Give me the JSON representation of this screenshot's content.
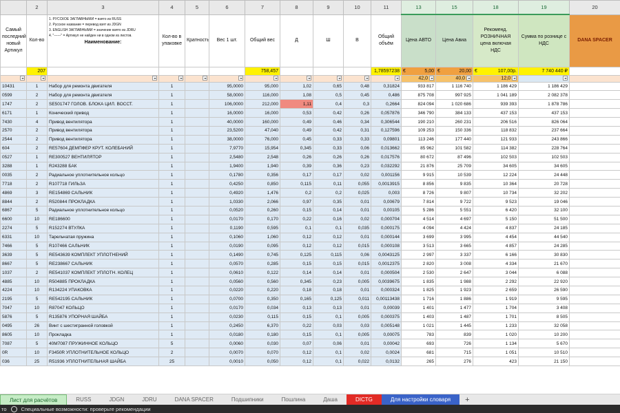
{
  "columns": [
    "",
    "2",
    "3",
    "4",
    "5",
    "6",
    "7",
    "8",
    "9",
    "10",
    "11",
    "13",
    "15",
    "18",
    "19",
    "20"
  ],
  "header": {
    "c1": "Самый последний новый Артикул",
    "c2": "Кол-во",
    "c3": [
      "1. РУССКОЕ ЗАГЛАВНЫМИ = взято из RUSS",
      "2. Русское название = перевод взят из JDGN",
      "3. ENGLISH ЗАГЛАВНЫМИ = значение взято из JDRU",
      "4. \"------\" = Артикул не найден ни в одном из листов."
    ],
    "c3_title": "Наименование:",
    "c4": "Кол-во в упаковке",
    "c5": "Кратность",
    "c6": "Вес 1 шт.",
    "c7": "Общий вес",
    "c8": "Д",
    "c9": "Ш",
    "c10": "В",
    "c11": "Общий объём",
    "c13": "Цена АВТО",
    "c15": "Цена Авиа",
    "c18": "Рекоменд. РОЗНИЧНАЯ цена включая НДС",
    "c19": "Сумма по рознице с НДС",
    "c20": "DANA SPACER"
  },
  "totals": {
    "qty": "207",
    "weight": "758,457",
    "volume": "1,78597238",
    "auto_cur": "€",
    "auto_val": "5,00",
    "avia_cur": "€",
    "avia_val": "20,00",
    "retail_cur": "€",
    "retail_val": "107,00р.",
    "sum": "7 740 440 ₽"
  },
  "filter": {
    "c13": "42,0",
    "c15": "40,0",
    "c18": "12,0"
  },
  "rows": [
    {
      "a": "10431",
      "q": "1",
      "n": "Набор для ремонта двигателя",
      "p": "1",
      "k": "",
      "w": "95,0000",
      "tw": "95,000",
      "d": "1,02",
      "s": "0,65",
      "h": "0,48",
      "v": "0,31824",
      "pa": "933 817",
      "pv": "1 116 740",
      "r": "1 186 429",
      "sum": "1 186 429"
    },
    {
      "a": "0599",
      "q": "2",
      "n": "Набор для ремонта двигателя",
      "p": "1",
      "k": "",
      "w": "58,0000",
      "tw": "116,000",
      "d": "1,08",
      "s": "0,5",
      "h": "0,45",
      "v": "0,486",
      "pa": "875 708",
      "pv": "997 925",
      "r": "1 041 189",
      "sum": "2 082 378"
    },
    {
      "a": "1747",
      "q": "2",
      "n": "SE501747 ГОЛОВ. БЛОКА ЦИЛ. ВОССТ.",
      "p": "1",
      "k": "",
      "w": "106,0000",
      "tw": "212,000",
      "d": "1,11",
      "s": "0,4",
      "h": "0,3",
      "v": "0,2664",
      "pa": "824 094",
      "pv": "1 020 686",
      "r": "939 393",
      "sum": "1 878 786",
      "red": true
    },
    {
      "a": "6171",
      "q": "1",
      "n": "Конический привод",
      "p": "1",
      "k": "",
      "w": "16,0000",
      "tw": "16,000",
      "d": "0,53",
      "s": "0,42",
      "h": "0,26",
      "v": "0,057876",
      "pa": "346 790",
      "pv": "384 133",
      "r": "437 153",
      "sum": "437 153"
    },
    {
      "a": "7430",
      "q": "4",
      "n": "Привод вентилятора",
      "p": "1",
      "k": "",
      "w": "40,0000",
      "tw": "160,000",
      "d": "0,49",
      "s": "0,46",
      "h": "0,34",
      "v": "0,306544",
      "pa": "190 210",
      "pv": "260 231",
      "r": "206 516",
      "sum": "826 064"
    },
    {
      "a": "2570",
      "q": "2",
      "n": "Привод вентилятора",
      "p": "1",
      "k": "",
      "w": "23,5200",
      "tw": "47,040",
      "d": "0,49",
      "s": "0,42",
      "h": "0,31",
      "v": "0,127596",
      "pa": "109 253",
      "pv": "150 336",
      "r": "118 832",
      "sum": "237 664"
    },
    {
      "a": "2544",
      "q": "2",
      "n": "Привод вентилятора",
      "p": "1",
      "k": "",
      "w": "38,0000",
      "tw": "76,000",
      "d": "0,45",
      "s": "0,33",
      "h": "0,33",
      "v": "0,09801",
      "pa": "113 246",
      "pv": "177 440",
      "r": "121 933",
      "sum": "243 866"
    },
    {
      "a": "604",
      "q": "2",
      "n": "RE57604 ДЕМПФЕР КРУТ. КОЛЕБАНИЙ",
      "p": "1",
      "k": "",
      "w": "7,9770",
      "tw": "15,954",
      "d": "0,345",
      "s": "0,33",
      "h": "0,06",
      "v": "0,013662",
      "pa": "85 962",
      "pv": "101 582",
      "r": "114 382",
      "sum": "228 764"
    },
    {
      "a": "0527",
      "q": "1",
      "n": "RE300527 ВЕНТИЛЯТОР",
      "p": "1",
      "k": "",
      "w": "2,5480",
      "tw": "2,548",
      "d": "0,26",
      "s": "0,26",
      "h": "0,26",
      "v": "0,017576",
      "pa": "80 672",
      "pv": "87 496",
      "r": "102 503",
      "sum": "102 503"
    },
    {
      "a": "3288",
      "q": "1",
      "n": "R243288 БАК",
      "p": "1",
      "k": "",
      "w": "1,9400",
      "tw": "1,940",
      "d": "0,39",
      "s": "0,36",
      "h": "0,23",
      "v": "0,032292",
      "pa": "21 876",
      "pv": "25 709",
      "r": "34 605",
      "sum": "34 605"
    },
    {
      "a": "0035",
      "q": "2",
      "n": "Радиальное уплотнительное кольцо",
      "p": "1",
      "k": "",
      "w": "0,1780",
      "tw": "0,356",
      "d": "0,17",
      "s": "0,17",
      "h": "0,02",
      "v": "0,001156",
      "pa": "9 915",
      "pv": "10 539",
      "r": "12 224",
      "sum": "24 448"
    },
    {
      "a": "7718",
      "q": "2",
      "n": "R107718 ГИЛЬЗА",
      "p": "1",
      "k": "",
      "w": "0,4250",
      "tw": "0,850",
      "d": "0,115",
      "s": "0,11",
      "h": "0,055",
      "v": "0,0013915",
      "pa": "8 856",
      "pv": "9 835",
      "r": "10 364",
      "sum": "20 728"
    },
    {
      "a": "4869",
      "q": "3",
      "n": "RE154869 САЛЬНИК",
      "p": "1",
      "k": "",
      "w": "0,4920",
      "tw": "1,476",
      "d": "0,2",
      "s": "0,2",
      "h": "0,025",
      "v": "0,003",
      "pa": "8 726",
      "pv": "9 807",
      "r": "10 734",
      "sum": "32 202"
    },
    {
      "a": "8844",
      "q": "2",
      "n": "R520844 ПРОКЛАДКА",
      "p": "1",
      "k": "",
      "w": "1,0330",
      "tw": "2,066",
      "d": "0,97",
      "s": "0,35",
      "h": "0,01",
      "v": "0,00679",
      "pa": "7 814",
      "pv": "9 722",
      "r": "9 523",
      "sum": "19 046"
    },
    {
      "a": "6867",
      "q": "5",
      "n": "Радиальное уплотнительное кольцо",
      "p": "1",
      "k": "",
      "w": "0,0520",
      "tw": "0,260",
      "d": "0,15",
      "s": "0,14",
      "h": "0,01",
      "v": "0,00105",
      "pa": "5 286",
      "pv": "5 551",
      "r": "6 420",
      "sum": "32 100"
    },
    {
      "a": "6600",
      "q": "10",
      "n": "RE186600",
      "p": "1",
      "k": "",
      "w": "0,0170",
      "tw": "0,170",
      "d": "0,22",
      "s": "0,16",
      "h": "0,02",
      "v": "0,000704",
      "pa": "4 514",
      "pv": "4 697",
      "r": "5 150",
      "sum": "51 500"
    },
    {
      "a": "2274",
      "q": "5",
      "n": "R152274 ВТУЛКА",
      "p": "1",
      "k": "",
      "w": "0,1190",
      "tw": "0,595",
      "d": "0,1",
      "s": "0,1",
      "h": "0,035",
      "v": "0,000175",
      "pa": "4 094",
      "pv": "4 424",
      "r": "4 837",
      "sum": "24 185"
    },
    {
      "a": "6331",
      "q": "10",
      "n": "Тарельчатая пружина",
      "p": "1",
      "k": "",
      "w": "0,1060",
      "tw": "1,060",
      "d": "0,12",
      "s": "0,12",
      "h": "0,01",
      "v": "0,000144",
      "pa": "3 699",
      "pv": "3 995",
      "r": "4 454",
      "sum": "44 540"
    },
    {
      "a": "7466",
      "q": "5",
      "n": "R107466 САЛЬНИК",
      "p": "1",
      "k": "",
      "w": "0,0190",
      "tw": "0,095",
      "d": "0,12",
      "s": "0,12",
      "h": "0,015",
      "v": "0,000108",
      "pa": "3 513",
      "pv": "3 665",
      "r": "4 857",
      "sum": "24 285"
    },
    {
      "a": "3639",
      "q": "5",
      "n": "RE543639 КОМПЛЕКТ УПЛОТНЕНИЙ",
      "p": "1",
      "k": "",
      "w": "0,1490",
      "tw": "0,745",
      "d": "0,125",
      "s": "0,115",
      "h": "0,06",
      "v": "0,0043125",
      "pa": "2 997",
      "pv": "3 337",
      "r": "6 166",
      "sum": "30 830"
    },
    {
      "a": "8667",
      "q": "5",
      "n": "RE238667 САЛЬНИК",
      "p": "1",
      "k": "",
      "w": "0,0570",
      "tw": "0,285",
      "d": "0,15",
      "s": "0,15",
      "h": "0,015",
      "v": "0,0012375",
      "pa": "2 820",
      "pv": "3 008",
      "r": "4 334",
      "sum": "21 670"
    },
    {
      "a": "1037",
      "q": "2",
      "n": "RE541037 КОМПЛЕКТ УПЛОТН. КОЛЕЦ",
      "p": "1",
      "k": "",
      "w": "0,0610",
      "tw": "0,122",
      "d": "0,14",
      "s": "0,14",
      "h": "0,01",
      "v": "0,000504",
      "pa": "2 530",
      "pv": "2 647",
      "r": "3 044",
      "sum": "6 088"
    },
    {
      "a": "4885",
      "q": "10",
      "n": "R504885 ПРОКЛАДКА",
      "p": "1",
      "k": "",
      "w": "0,0560",
      "tw": "0,560",
      "d": "0,345",
      "s": "0,23",
      "h": "0,005",
      "v": "0,0039675",
      "pa": "1 835",
      "pv": "1 988",
      "r": "2 292",
      "sum": "22 920"
    },
    {
      "a": "4224",
      "q": "10",
      "n": "R134224 УПАКОВКА",
      "p": "1",
      "k": "",
      "w": "0,0220",
      "tw": "0,220",
      "d": "0,18",
      "s": "0,18",
      "h": "0,01",
      "v": "0,000324",
      "pa": "1 825",
      "pv": "1 923",
      "r": "2 659",
      "sum": "26 590"
    },
    {
      "a": "2195",
      "q": "5",
      "n": "RE542195 САЛЬНИК",
      "p": "1",
      "k": "",
      "w": "0,0700",
      "tw": "0,350",
      "d": "0,165",
      "s": "0,125",
      "h": "0,011",
      "v": "0,00113438",
      "pa": "1 716",
      "pv": "1 886",
      "r": "1 919",
      "sum": "9 595"
    },
    {
      "a": "7047",
      "q": "10",
      "n": "R87047 КОЛЬЦО",
      "p": "1",
      "k": "",
      "w": "0,0170",
      "tw": "0,034",
      "d": "0,13",
      "s": "0,13",
      "h": "0,01",
      "v": "0,00039",
      "pa": "1 401",
      "pv": "1 477",
      "r": "1 704",
      "sum": "3 408"
    },
    {
      "a": "5876",
      "q": "5",
      "n": "R135876 УПОРНАЯ ШАЙБА",
      "p": "1",
      "k": "",
      "w": "0,0230",
      "tw": "0,115",
      "d": "0,15",
      "s": "0,1",
      "h": "0,005",
      "v": "0,000375",
      "pa": "1 403",
      "pv": "1 487",
      "r": "1 701",
      "sum": "8 505"
    },
    {
      "a": "0495",
      "q": "26",
      "n": "Винт с шестигранной головкой",
      "p": "1",
      "k": "",
      "w": "0,2450",
      "tw": "6,370",
      "d": "0,22",
      "s": "0,03",
      "h": "0,03",
      "v": "0,005148",
      "pa": "1 021",
      "pv": "1 445",
      "r": "1 233",
      "sum": "32 058"
    },
    {
      "a": "8605",
      "q": "10",
      "n": "Прокладка",
      "p": "1",
      "k": "",
      "w": "0,0180",
      "tw": "0,180",
      "d": "0,15",
      "s": "0,1",
      "h": "0,005",
      "v": "0,00075",
      "pa": "783",
      "pv": "839",
      "r": "1 020",
      "sum": "10 200"
    },
    {
      "a": "7087",
      "q": "5",
      "n": "40M7087 ПРУЖИННОЕ КОЛЬЦО",
      "p": "5",
      "k": "",
      "w": "0,0060",
      "tw": "0,030",
      "d": "0,07",
      "s": "0,06",
      "h": "0,01",
      "v": "0,00042",
      "pa": "693",
      "pv": "726",
      "r": "1 134",
      "sum": "5 670"
    },
    {
      "a": "0R",
      "q": "10",
      "n": "F3450R УПЛОТНИТЕЛЬНОЕ КОЛЬЦО",
      "p": "2",
      "k": "",
      "w": "0,0070",
      "tw": "0,070",
      "d": "0,12",
      "s": "0,1",
      "h": "0,02",
      "v": "0,0024",
      "pa": "681",
      "pv": "715",
      "r": "1 051",
      "sum": "10 510"
    },
    {
      "a": "036",
      "q": "25",
      "n": "R51936 УПЛОТНИТЕЛЬНАЯ ШАЙБА",
      "p": "25",
      "k": "",
      "w": "0,0010",
      "tw": "0,050",
      "d": "0,12",
      "s": "0,1",
      "h": "0,022",
      "v": "0,0132",
      "pa": "265",
      "pv": "276",
      "r": "423",
      "sum": "21 150"
    }
  ],
  "tabs": [
    {
      "label": "Лист для расчётов",
      "style": "active"
    },
    {
      "label": "RUSS",
      "style": ""
    },
    {
      "label": "JDGN",
      "style": ""
    },
    {
      "label": "JDRU",
      "style": ""
    },
    {
      "label": "DANA SPACER",
      "style": ""
    },
    {
      "label": "Подшипники",
      "style": ""
    },
    {
      "label": "Пошлина",
      "style": ""
    },
    {
      "label": "Даша",
      "style": ""
    },
    {
      "label": "DICTG",
      "style": "red"
    },
    {
      "label": "Для настройки словаря",
      "style": "blue"
    }
  ],
  "tab_add": "+",
  "status": {
    "left": "то",
    "text": "Специальные возможности: проверьте рекомендации"
  },
  "colors": {
    "row_bg": "#dfeaf5",
    "header_green": "#c9dfc9",
    "totals_yellow": "#fff200",
    "dana_orange": "#e99a45",
    "alert_red": "#f08a80",
    "active_tab": "#c6ecc6",
    "dictg_tab": "#e22b25",
    "dict_tab": "#3a63c8"
  }
}
